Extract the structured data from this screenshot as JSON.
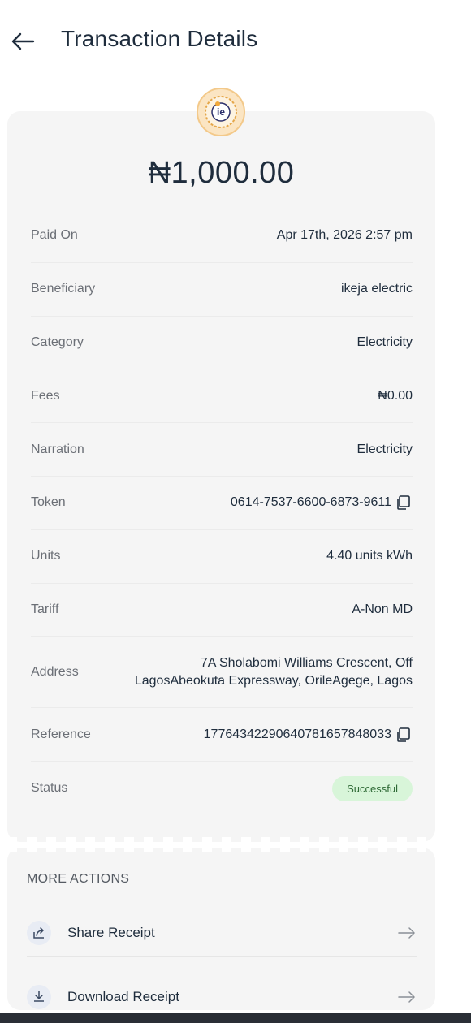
{
  "header": {
    "title": "Transaction Details",
    "back_icon": "arrow-left-icon"
  },
  "logo": {
    "icon": "ikeja-electric-logo",
    "text": "ie"
  },
  "amount": "₦1,000.00",
  "details": [
    {
      "label": "Paid On",
      "value": "Apr 17th, 2026 2:57 pm"
    },
    {
      "label": "Beneficiary",
      "value": "ikeja electric"
    },
    {
      "label": "Category",
      "value": "Electricity"
    },
    {
      "label": "Fees",
      "value": "₦0.00"
    },
    {
      "label": "Narration",
      "value": "Electricity"
    },
    {
      "label": "Token",
      "value": "0614-7537-6600-6873-9611",
      "copy_icon": "copy-icon"
    },
    {
      "label": "Units",
      "value": "4.40 units kWh"
    },
    {
      "label": "Tariff",
      "value": "A-Non MD"
    },
    {
      "label": "Address",
      "value_line1": "7A Sholabomi Williams Crescent, Off",
      "value_line2": "LagosAbeokuta Expressway, OrileAgege, Lagos"
    },
    {
      "label": "Reference",
      "value": "17764342290640781657848033",
      "copy_icon": "copy-icon"
    },
    {
      "label": "Status",
      "value": "Successful"
    }
  ],
  "more_actions": {
    "title": "MORE ACTIONS",
    "items": [
      {
        "label": "Share Receipt",
        "icon": "share-icon",
        "arrow": "arrow-right-icon"
      },
      {
        "label": "Download Receipt",
        "icon": "download-icon",
        "arrow": "arrow-right-icon"
      }
    ]
  },
  "colors": {
    "text_dark": "#1f2d3d",
    "label_grey": "#6b6f76",
    "card_bg": "#f5f5f5",
    "status_bg": "#d8f5d9",
    "status_text": "#2f6a36",
    "logo_bg": "#fbe5c3"
  }
}
